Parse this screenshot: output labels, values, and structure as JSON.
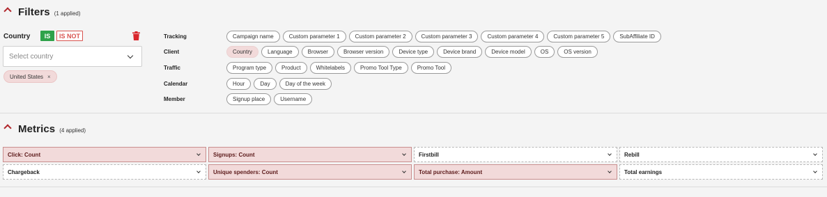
{
  "filters": {
    "title": "Filters",
    "count": "(1 applied)",
    "country": {
      "label": "Country",
      "is_label": "IS",
      "is_not_label": "IS NOT",
      "placeholder": "Select country",
      "selected_tags": [
        {
          "label": "United States",
          "remove": "×"
        }
      ]
    },
    "rows": [
      {
        "label": "Tracking",
        "chips": [
          {
            "label": "Campaign name",
            "active": false
          },
          {
            "label": "Custom parameter 1",
            "active": false
          },
          {
            "label": "Custom parameter 2",
            "active": false
          },
          {
            "label": "Custom parameter 3",
            "active": false
          },
          {
            "label": "Custom parameter 4",
            "active": false
          },
          {
            "label": "Custom parameter 5",
            "active": false
          },
          {
            "label": "SubAffiliate ID",
            "active": false
          }
        ]
      },
      {
        "label": "Client",
        "chips": [
          {
            "label": "Country",
            "active": true
          },
          {
            "label": "Language",
            "active": false
          },
          {
            "label": "Browser",
            "active": false
          },
          {
            "label": "Browser version",
            "active": false
          },
          {
            "label": "Device type",
            "active": false
          },
          {
            "label": "Device brand",
            "active": false
          },
          {
            "label": "Device model",
            "active": false
          },
          {
            "label": "OS",
            "active": false
          },
          {
            "label": "OS version",
            "active": false
          }
        ]
      },
      {
        "label": "Traffic",
        "chips": [
          {
            "label": "Program type",
            "active": false
          },
          {
            "label": "Product",
            "active": false
          },
          {
            "label": "Whitelabels",
            "active": false
          },
          {
            "label": "Promo Tool Type",
            "active": false
          },
          {
            "label": "Promo Tool",
            "active": false
          }
        ]
      },
      {
        "label": "Calendar",
        "chips": [
          {
            "label": "Hour",
            "active": false
          },
          {
            "label": "Day",
            "active": false
          },
          {
            "label": "Day of the week",
            "active": false
          }
        ]
      },
      {
        "label": "Member",
        "chips": [
          {
            "label": "Signup place",
            "active": false
          },
          {
            "label": "Username",
            "active": false
          }
        ]
      }
    ]
  },
  "metrics": {
    "title": "Metrics",
    "count": "(4 applied)",
    "items": [
      {
        "label": "Click: Count",
        "active": true
      },
      {
        "label": "Signups: Count",
        "active": true
      },
      {
        "label": "Firstbill",
        "active": false
      },
      {
        "label": "Rebill",
        "active": false
      },
      {
        "label": "Chargeback",
        "active": false
      },
      {
        "label": "Unique spenders: Count",
        "active": true
      },
      {
        "label": "Total purchase: Amount",
        "active": true
      },
      {
        "label": "Total earnings",
        "active": false
      }
    ]
  },
  "colors": {
    "accent": "#b0252a",
    "is_green": "#2fa24a",
    "active_fill": "#f2dada"
  }
}
